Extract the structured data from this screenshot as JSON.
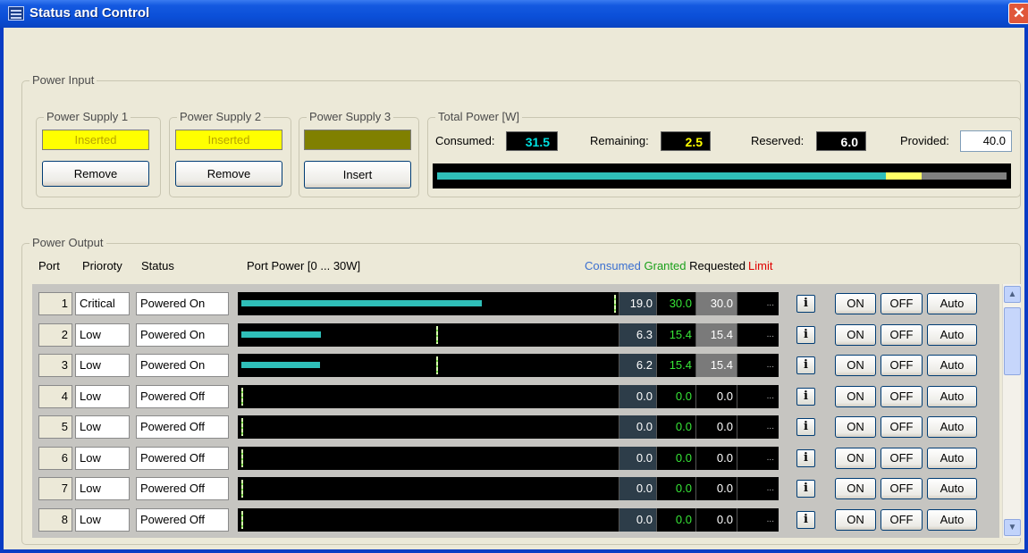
{
  "window": {
    "title": "Status and Control"
  },
  "power_input": {
    "group_label": "Power Input",
    "supplies": [
      {
        "label": "Power Supply 1",
        "status": "Inserted",
        "status_color": "#ffff00",
        "button": "Remove"
      },
      {
        "label": "Power Supply 2",
        "status": "Inserted",
        "status_color": "#ffff00",
        "button": "Remove"
      },
      {
        "label": "Power Supply 3",
        "status": "",
        "status_color": "#808000",
        "button": "Insert"
      }
    ],
    "total_power": {
      "label": "Total Power [W]",
      "consumed_label": "Consumed:",
      "consumed": "31.5",
      "consumed_color": "#00e0e0",
      "remaining_label": "Remaining:",
      "remaining": "2.5",
      "remaining_color": "#ffff00",
      "reserved_label": "Reserved:",
      "reserved": "6.0",
      "provided_label": "Provided:",
      "provided": "40.0",
      "bar_fractions": {
        "consumed": 0.7875,
        "remaining": 0.0625,
        "reserved": 0.15
      }
    }
  },
  "power_output": {
    "group_label": "Power Output",
    "headers": {
      "port": "Port",
      "priority": "Prioroty",
      "status": "Status",
      "port_power": "Port Power [0 ... 30W]"
    },
    "legend": [
      {
        "text": "Consumed",
        "color": "#3a6fd0"
      },
      {
        "text": "Granted",
        "color": "#1aa01a"
      },
      {
        "text": "Requested",
        "color": "#000000"
      },
      {
        "text": "Limit",
        "color": "#e00000"
      }
    ],
    "info_label": "i",
    "on_label": "ON",
    "off_label": "OFF",
    "auto_label": "Auto",
    "ellipsis": "...",
    "rows": [
      {
        "port": "1",
        "priority": "Critical",
        "status": "Powered On",
        "consumed": "19.0",
        "granted": "30.0",
        "requested": "30.0",
        "consumed_fraction": 0.633,
        "granted_fraction": 1.0
      },
      {
        "port": "2",
        "priority": "Low",
        "status": "Powered On",
        "consumed": "6.3",
        "granted": "15.4",
        "requested": "15.4",
        "consumed_fraction": 0.21,
        "granted_fraction": 0.513
      },
      {
        "port": "3",
        "priority": "Low",
        "status": "Powered On",
        "consumed": "6.2",
        "granted": "15.4",
        "requested": "15.4",
        "consumed_fraction": 0.207,
        "granted_fraction": 0.513
      },
      {
        "port": "4",
        "priority": "Low",
        "status": "Powered Off",
        "consumed": "0.0",
        "granted": "0.0",
        "requested": "0.0",
        "consumed_fraction": 0,
        "granted_fraction": 0
      },
      {
        "port": "5",
        "priority": "Low",
        "status": "Powered Off",
        "consumed": "0.0",
        "granted": "0.0",
        "requested": "0.0",
        "consumed_fraction": 0,
        "granted_fraction": 0
      },
      {
        "port": "6",
        "priority": "Low",
        "status": "Powered Off",
        "consumed": "0.0",
        "granted": "0.0",
        "requested": "0.0",
        "consumed_fraction": 0,
        "granted_fraction": 0
      },
      {
        "port": "7",
        "priority": "Low",
        "status": "Powered Off",
        "consumed": "0.0",
        "granted": "0.0",
        "requested": "0.0",
        "consumed_fraction": 0,
        "granted_fraction": 0
      },
      {
        "port": "8",
        "priority": "Low",
        "status": "Powered Off",
        "consumed": "0.0",
        "granted": "0.0",
        "requested": "0.0",
        "consumed_fraction": 0,
        "granted_fraction": 0
      }
    ]
  },
  "colors": {
    "titlebar": "#0b4fd8",
    "bar_cyan": "#2fbfb9",
    "bar_yellow": "#ffff66",
    "bar_gray": "#808080"
  }
}
